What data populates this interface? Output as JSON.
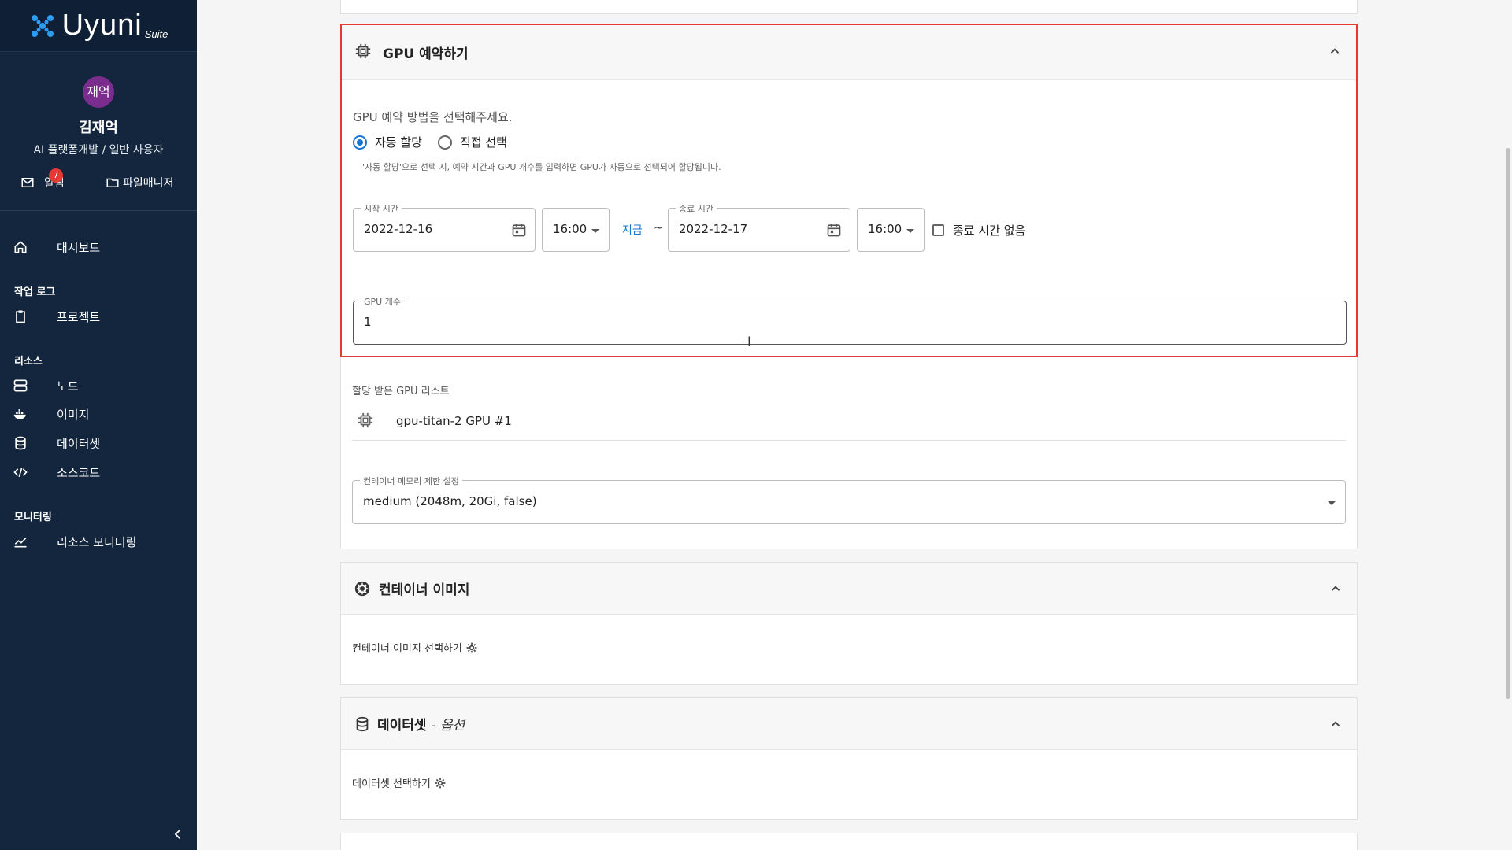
{
  "brand": {
    "name": "Uyuni",
    "suffix": "Suite"
  },
  "user": {
    "avatar_text": "재억",
    "name": "김재억",
    "role": "AI 플랫폼개발 / 일반 사용자"
  },
  "quick": {
    "notify_label": "알림",
    "notify_count": "7",
    "files_label": "파일매니저"
  },
  "nav": {
    "dashboard": "대시보드",
    "section_worklog": "작업 로그",
    "project": "프로젝트",
    "section_resource": "리소스",
    "node": "노드",
    "image": "이미지",
    "dataset": "데이터셋",
    "sourcecode": "소스코드",
    "section_monitoring": "모니터링",
    "resource_monitoring": "리소스 모니터링"
  },
  "gpu_card": {
    "title": "GPU 예약하기",
    "method_prompt": "GPU 예약 방법을 선택해주세요.",
    "radio_auto": "자동 할당",
    "radio_manual": "직접 선택",
    "hint": "'자동 할당'으로 선택 시, 예약 시간과 GPU 개수를 입력하면 GPU가 자동으로 선택되어 할당됩니다.",
    "start_label": "시작 시간",
    "start_date": "2022-12-16",
    "start_time": "16:00",
    "now_link": "지금",
    "tilde": "~",
    "end_label": "종료 시간",
    "end_date": "2022-12-17",
    "end_time": "16:00",
    "no_end_label": "종료 시간 없음",
    "gpu_count_label": "GPU 개수",
    "gpu_count_value": "1"
  },
  "assigned": {
    "title": "할당 받은 GPU 리스트",
    "items": [
      "gpu-titan-2 GPU #1"
    ]
  },
  "memory": {
    "label": "컨테이너 메모리 제한 설정",
    "value": "medium (2048m, 20Gi, false)"
  },
  "container_card": {
    "title": "컨테이너 이미지",
    "select_label": "컨테이너 이미지 선택하기"
  },
  "dataset_card": {
    "title": "데이터셋",
    "optional": "- 옵션",
    "select_label": "데이터셋 선택하기"
  },
  "colors": {
    "sidebar": "#13263e",
    "accent": "#1976d2",
    "highlight": "#e53935",
    "avatar": "#7b2d8e"
  }
}
